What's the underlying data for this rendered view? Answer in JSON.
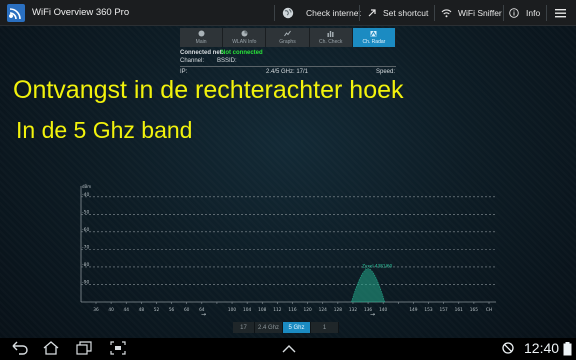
{
  "header": {
    "title": "WiFi Overview 360 Pro",
    "actions": [
      {
        "label": "Check internet",
        "icon": "globe-icon"
      },
      {
        "label": "Set shortcut",
        "icon": "pin-icon"
      },
      {
        "label": "WiFi Sniffer",
        "icon": "wifi-icon"
      },
      {
        "label": "Info",
        "icon": "info-icon"
      }
    ],
    "menu_icon": "overflow-menu-icon"
  },
  "tabs": [
    {
      "label": "Main",
      "icon": "radio-icon"
    },
    {
      "label": "WLAN Info",
      "icon": "pie-icon"
    },
    {
      "label": "Graphs",
      "icon": "graph-icon"
    },
    {
      "label": "Ch. Check",
      "icon": "bars-icon"
    },
    {
      "label": "Ch. Radar",
      "icon": "radar-icon",
      "active": true
    }
  ],
  "connection": {
    "connected_label": "Connected net:",
    "connected_value": "Not connected",
    "channel_label": "Channel:",
    "bssid_label": "BSSID:",
    "ip_label": "IP:",
    "band_text": "2.4/5 GHz: 17/1",
    "speed_label": "Speed:"
  },
  "overlay": {
    "line1": "Ontvangst in de rechterachter hoek",
    "line2": "In de 5 Ghz band"
  },
  "chart_data": {
    "type": "area",
    "y_unit_label": "dBm",
    "y_ticks": [
      "-40",
      "-50",
      "-60",
      "-70",
      "-80",
      "-90"
    ],
    "ylim": [
      -100,
      -35
    ],
    "x_ticks": [
      "36",
      "40",
      "44",
      "48",
      "52",
      "56",
      "60",
      "64",
      "",
      "100",
      "104",
      "108",
      "112",
      "116",
      "120",
      "124",
      "128",
      "132",
      "136",
      "140",
      "",
      "149",
      "153",
      "157",
      "161",
      "165",
      "CH"
    ],
    "grid": true,
    "series": [
      {
        "channel": "136",
        "peak_dbm": -81,
        "label": "Zyxel 4381/60"
      }
    ],
    "colors": {
      "grid": "#8a949a",
      "signal": "#25a88a"
    }
  },
  "band_selector": {
    "buttons": [
      {
        "label": "17",
        "active": false
      },
      {
        "label": "2.4 Ghz",
        "active": false
      },
      {
        "label": "5 Ghz",
        "active": true
      },
      {
        "label": "1",
        "active": false
      }
    ]
  },
  "status_bar": {
    "clock": "12:40",
    "nav_icons": [
      "back-icon",
      "home-icon",
      "recent-apps-icon",
      "screenshot-icon",
      "up-chevron-icon"
    ]
  }
}
